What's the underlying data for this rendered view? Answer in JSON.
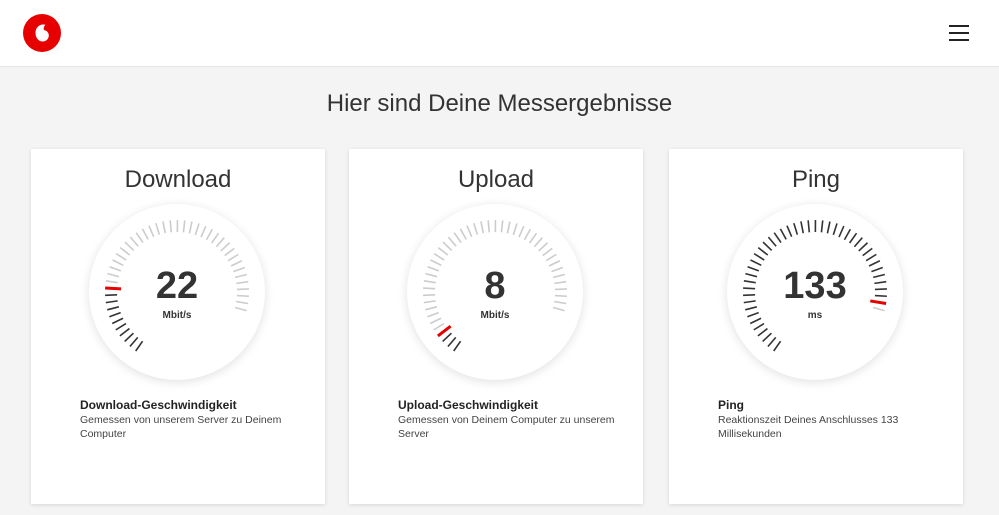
{
  "header": {
    "logo_icon": "vodafone-speechmark-logo",
    "menu_icon": "hamburger-menu-icon",
    "brand_color": "#e60000"
  },
  "page": {
    "title": "Hier sind Deine Messergebnisse"
  },
  "cards": [
    {
      "title": "Download",
      "value": "22",
      "unit": "Mbit/s",
      "gauge_fraction": 0.23,
      "info_title": "Download-Geschwindigkeit",
      "info_desc": "Gemessen von unserem Server zu Deinem Computer"
    },
    {
      "title": "Upload",
      "value": "8",
      "unit": "Mbit/s",
      "gauge_fraction": 0.08,
      "info_title": "Upload-Geschwindigkeit",
      "info_desc": "Gemessen von Deinem Computer zu unserem Server"
    },
    {
      "title": "Ping",
      "value": "133",
      "unit": "ms",
      "gauge_fraction": 0.97,
      "info_title": "Ping",
      "info_desc": "Reaktionszeit Deines Anschlusses 133 Millisekunden"
    }
  ],
  "colors": {
    "active_tick": "#333333",
    "inactive_tick": "#cccccc",
    "marker": "#e60000"
  }
}
